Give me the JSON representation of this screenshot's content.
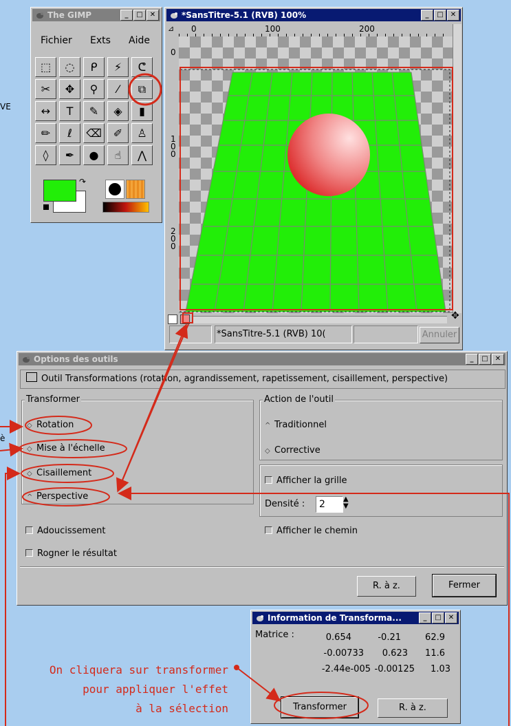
{
  "toolbox": {
    "title": "The GIMP",
    "menu": [
      "Fichier",
      "Exts",
      "Aide"
    ],
    "tools": [
      {
        "name": "rect-select-icon",
        "glyph": "⬚"
      },
      {
        "name": "ellipse-select-icon",
        "glyph": "◌"
      },
      {
        "name": "lasso-icon",
        "glyph": "ᑭ"
      },
      {
        "name": "magic-wand-icon",
        "glyph": "⚡"
      },
      {
        "name": "bezier-select-icon",
        "glyph": "ᕦ"
      },
      {
        "name": "intelligent-scissors-icon",
        "glyph": "✂"
      },
      {
        "name": "move-icon",
        "glyph": "✥"
      },
      {
        "name": "zoom-icon",
        "glyph": "⚲"
      },
      {
        "name": "crop-icon",
        "glyph": "⁄"
      },
      {
        "name": "transform-icon",
        "glyph": "⧉"
      },
      {
        "name": "flip-icon",
        "glyph": "↔"
      },
      {
        "name": "text-icon",
        "glyph": "T"
      },
      {
        "name": "color-picker-icon",
        "glyph": "✎"
      },
      {
        "name": "bucket-fill-icon",
        "glyph": "◈"
      },
      {
        "name": "gradient-icon",
        "glyph": "▮"
      },
      {
        "name": "pencil-icon",
        "glyph": "✏"
      },
      {
        "name": "paintbrush-icon",
        "glyph": "ℓ"
      },
      {
        "name": "eraser-icon",
        "glyph": "⌫"
      },
      {
        "name": "airbrush-icon",
        "glyph": "✐"
      },
      {
        "name": "clone-icon",
        "glyph": "♙"
      },
      {
        "name": "blur-icon",
        "glyph": "◊"
      },
      {
        "name": "ink-icon",
        "glyph": "✒"
      },
      {
        "name": "dodge-burn-icon",
        "glyph": "●"
      },
      {
        "name": "smudge-icon",
        "glyph": "☝"
      },
      {
        "name": "measure-icon",
        "glyph": "⋀"
      }
    ]
  },
  "image_window": {
    "title": "*SansTitre-5.1 (RVB) 100%",
    "ruler_h": [
      "0",
      "100",
      "200"
    ],
    "ruler_v": [
      "0",
      "100",
      "200"
    ],
    "status_text": "*SansTitre-5.1 (RVB) 10(",
    "cancel_label": "Annuler"
  },
  "tool_options": {
    "title": "Options des outils",
    "header": "Outil Transformations (rotation, agrandissement, rapetissement, cisaillement, perspective)",
    "transform_group": "Transformer",
    "transform_options": [
      "Rotation",
      "Mise à l'échelle",
      "Cisaillement",
      "Perspective"
    ],
    "action_group": "Action de l'outil",
    "action_options": [
      "Traditionnel",
      "Corrective"
    ],
    "show_grid": "Afficher la grille",
    "density_label": "Densité :",
    "density_value": "2",
    "smoothing": "Adoucissement",
    "clip_result": "Rogner le résultat",
    "show_path": "Afficher le chemin",
    "reset_label": "R. à z.",
    "close_label": "Fermer"
  },
  "transform_info": {
    "title": "Information de Transforma...",
    "matrix_label": "Matrice :",
    "matrix": [
      [
        "0.654",
        "-0.21",
        "62.9"
      ],
      [
        "-0.00733",
        "0.623",
        "11.6"
      ],
      [
        "-2.44e-005",
        "-0.00125",
        "1.03"
      ]
    ],
    "transform_label": "Transformer",
    "reset_label": "R. à z."
  },
  "annotation": {
    "lines": [
      "On cliquera sur transformer",
      "pour appliquer l'effet",
      "à la sélection"
    ],
    "color": "#d42a1a"
  },
  "edge_fragments": [
    "VE",
    "è"
  ],
  "colors": {
    "desktop": "#a9cdef",
    "titlebar_active": "#081a72",
    "canvas_green": "#22ee08",
    "annotation_red": "#d42a1a"
  }
}
